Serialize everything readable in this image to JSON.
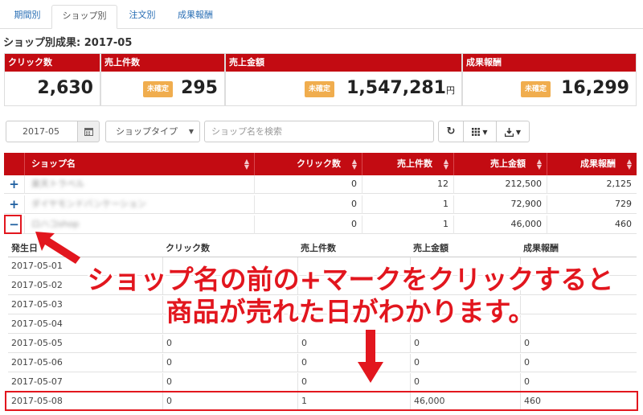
{
  "tabs": [
    {
      "label": "期間別",
      "active": false
    },
    {
      "label": "ショップ別",
      "active": true
    },
    {
      "label": "注文別",
      "active": false
    },
    {
      "label": "成果報酬",
      "active": false
    }
  ],
  "page_title": "ショップ別成果: 2017-05",
  "kpis": [
    {
      "label": "クリック数",
      "value": "2,630",
      "badge": "",
      "unit": ""
    },
    {
      "label": "売上件数",
      "value": "295",
      "badge": "未確定",
      "unit": ""
    },
    {
      "label": "売上金額",
      "value": "1,547,281",
      "badge": "未確定",
      "unit": "円"
    },
    {
      "label": "成果報酬",
      "value": "16,299",
      "badge": "未確定",
      "unit": ""
    }
  ],
  "toolbar": {
    "date_value": "2017-05",
    "shop_type_label": "ショップタイプ",
    "search_placeholder": "ショップ名を検索",
    "refresh_icon": "refresh-icon",
    "columns_icon": "grid-icon",
    "download_icon": "download-icon"
  },
  "table": {
    "columns": [
      "ショップ名",
      "クリック数",
      "売上件数",
      "売上金額",
      "成果報酬"
    ],
    "rows": [
      {
        "toggle": "+",
        "shop": "楽天トラベル",
        "clicks": "0",
        "sales_count": "12",
        "sales_amount": "212,500",
        "reward": "2,125"
      },
      {
        "toggle": "+",
        "shop": "ダイヤモンドバンケーション",
        "clicks": "0",
        "sales_count": "1",
        "sales_amount": "72,900",
        "reward": "729"
      },
      {
        "toggle": "−",
        "shop": "ロハコshop",
        "clicks": "0",
        "sales_count": "1",
        "sales_amount": "46,000",
        "reward": "460"
      }
    ]
  },
  "daily": {
    "columns": [
      "発生日",
      "クリック数",
      "売上件数",
      "売上金額",
      "成果報酬"
    ],
    "rows": [
      [
        "2017-05-01",
        "",
        "",
        "",
        ""
      ],
      [
        "2017-05-02",
        "",
        "",
        "",
        ""
      ],
      [
        "2017-05-03",
        "",
        "",
        "",
        ""
      ],
      [
        "2017-05-04",
        "",
        "",
        "",
        ""
      ],
      [
        "2017-05-05",
        "0",
        "0",
        "0",
        "0"
      ],
      [
        "2017-05-06",
        "0",
        "0",
        "0",
        "0"
      ],
      [
        "2017-05-07",
        "0",
        "0",
        "0",
        "0"
      ],
      [
        "2017-05-08",
        "0",
        "1",
        "46,000",
        "460"
      ]
    ]
  },
  "annotation": {
    "line1": "ショップ名の前の+マークをクリックすると",
    "line2": "商品が売れた日がわかります。",
    "color": "#e2161e"
  },
  "colors": {
    "header_red": "#c30b12",
    "badge_orange": "#f0ad4e",
    "link_blue": "#2a6fb5"
  }
}
